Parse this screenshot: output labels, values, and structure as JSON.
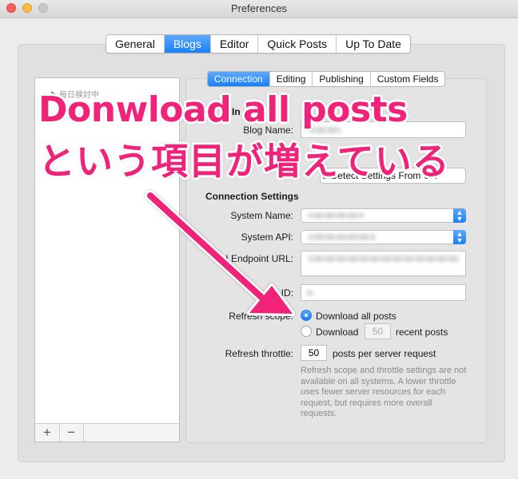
{
  "window": {
    "title": "Preferences"
  },
  "top_tabs": [
    {
      "label": "General",
      "active": false
    },
    {
      "label": "Blogs",
      "active": true
    },
    {
      "label": "Editor",
      "active": false
    },
    {
      "label": "Quick Posts",
      "active": false
    },
    {
      "label": "Up To Date",
      "active": false
    }
  ],
  "sub_tabs": [
    {
      "label": "Connection",
      "active": true
    },
    {
      "label": "Editing",
      "active": false
    },
    {
      "label": "Publishing",
      "active": false
    },
    {
      "label": "Custom Fields",
      "active": false
    }
  ],
  "blog_list": {
    "item_label": "毎日検討中",
    "add_label": "+",
    "remove_label": "−"
  },
  "connection": {
    "blog_info_heading_partial": "In",
    "blog_name_label": "Blog Name:",
    "autodetect_button_partial": "o-Detect Settings From UR",
    "settings_heading": "Connection Settings",
    "system_name_label": "System Name:",
    "system_api_label": "System API:",
    "api_endpoint_label_partial": "I Endpoint URL:",
    "blog_id_label_partial": "g ID:",
    "refresh_scope_label": "Refresh scope:",
    "scope_all_label": "Download all posts",
    "scope_recent_label": "Download",
    "recent_count": "50",
    "recent_suffix": "recent posts",
    "refresh_throttle_label": "Refresh throttle:",
    "throttle_value": "50",
    "throttle_suffix": "posts per server request",
    "help_text": "Refresh scope and throttle settings are not available on all systems. A lower throttle uses fewer server resources for each request, but requires more overall requests."
  },
  "overlay": {
    "line1": "Donwload all posts",
    "line2": "という項目が増えている",
    "color": "#f0227a"
  },
  "colors": {
    "accent": "#1a80f7"
  }
}
